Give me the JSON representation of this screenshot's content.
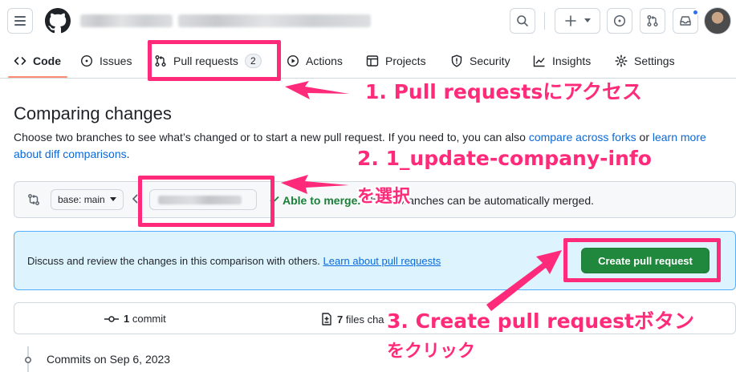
{
  "header": {
    "menu_icon": "hamburger-icon",
    "logo_icon": "github-logo-icon",
    "buttons": [
      "search-icon",
      "plus-icon",
      "issue-icon",
      "pull-request-icon",
      "inbox-icon"
    ]
  },
  "nav": {
    "tabs": [
      {
        "label": "Code",
        "icon": "code-icon"
      },
      {
        "label": "Issues",
        "icon": "issue-opened-icon"
      },
      {
        "label": "Pull requests",
        "icon": "pull-request-icon",
        "count": "2"
      },
      {
        "label": "Actions",
        "icon": "play-icon"
      },
      {
        "label": "Projects",
        "icon": "table-icon"
      },
      {
        "label": "Security",
        "icon": "shield-icon"
      },
      {
        "label": "Insights",
        "icon": "graph-icon"
      },
      {
        "label": "Settings",
        "icon": "gear-icon"
      }
    ]
  },
  "main": {
    "title": "Comparing changes",
    "desc_text": "Choose two branches to see what’s changed or to start a new pull request. If you need to, you can also ",
    "desc_link1": "compare across forks",
    "desc_or": " or ",
    "desc_link2": "learn more about diff comparisons",
    "desc_end": ".",
    "base_branch": "base: main",
    "merge_status_bold": "Able to merge.",
    "merge_status_rest": " These branches can be automatically merged.",
    "discuss_text": "Discuss and review the changes in this comparison with others. ",
    "discuss_link": "Learn about pull requests",
    "create_button": "Create pull request",
    "commits_count": "1",
    "commits_label": " commit",
    "files_count": "7",
    "files_label": " files cha",
    "commits_on": "Commits on Sep 6, 2023"
  },
  "annotations": {
    "step1": "1. Pull requestsにアクセス",
    "step2_line1": "2. 1_update-company-info",
    "step2_line2": "を選択",
    "step3_line1": "3. Create pull requestボタン",
    "step3_line2": "をクリック",
    "color": "#ff2a7a"
  }
}
